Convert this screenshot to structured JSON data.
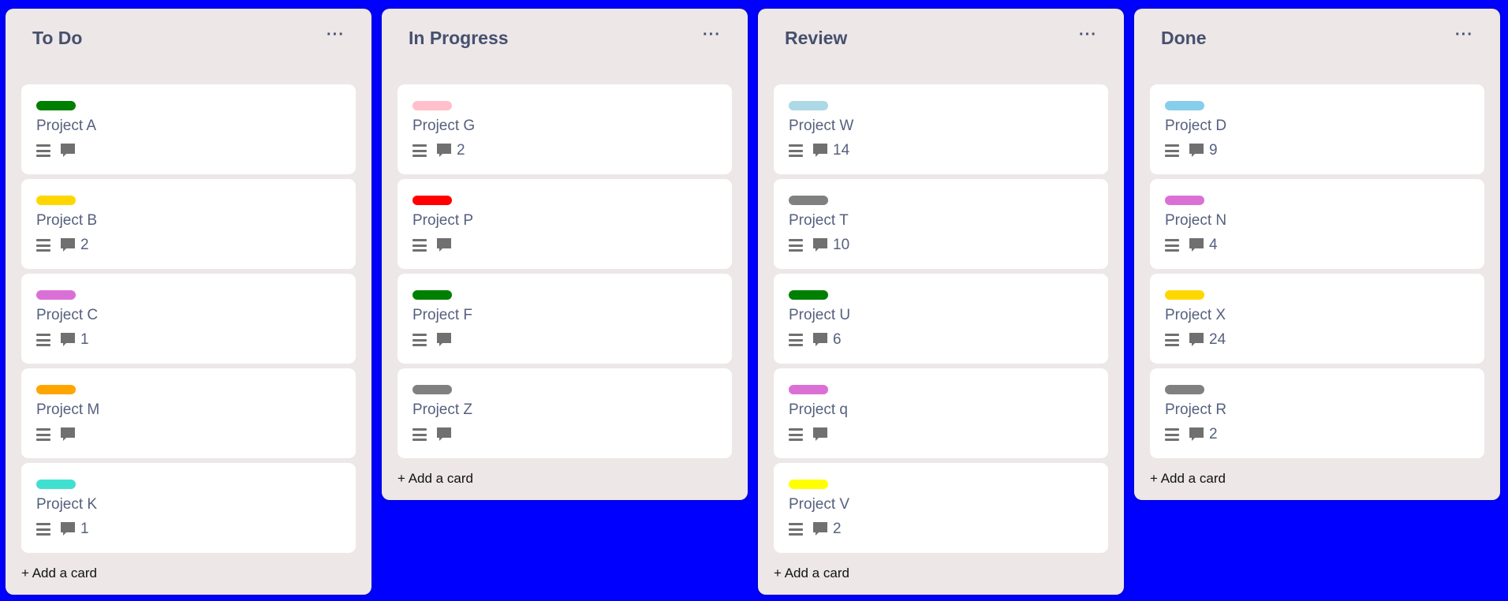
{
  "columns": [
    {
      "title": "To Do",
      "menu": "···",
      "add_card": "+ Add a card",
      "cards": [
        {
          "title": "Project A",
          "label_color": "#008000",
          "comments": ""
        },
        {
          "title": "Project B",
          "label_color": "#ffd700",
          "comments": "2"
        },
        {
          "title": "Project C",
          "label_color": "#da70d6",
          "comments": "1"
        },
        {
          "title": "Project M",
          "label_color": "#ffa500",
          "comments": ""
        },
        {
          "title": "Project K",
          "label_color": "#40e0d0",
          "comments": "1"
        }
      ]
    },
    {
      "title": "In Progress",
      "menu": "···",
      "add_card": "+ Add a card",
      "cards": [
        {
          "title": "Project G",
          "label_color": "#ffc0cb",
          "comments": "2"
        },
        {
          "title": "Project P",
          "label_color": "#ff0000",
          "comments": ""
        },
        {
          "title": "Project F",
          "label_color": "#008000",
          "comments": ""
        },
        {
          "title": "Project Z",
          "label_color": "#808080",
          "comments": ""
        }
      ]
    },
    {
      "title": "Review",
      "menu": "···",
      "add_card": "+ Add a card",
      "cards": [
        {
          "title": "Project W",
          "label_color": "#add8e6",
          "comments": "14"
        },
        {
          "title": "Project T",
          "label_color": "#808080",
          "comments": "10"
        },
        {
          "title": "Project U",
          "label_color": "#008000",
          "comments": "6"
        },
        {
          "title": "Project q",
          "label_color": "#da70d6",
          "comments": ""
        },
        {
          "title": "Project V",
          "label_color": "#ffff00",
          "comments": "2"
        }
      ]
    },
    {
      "title": "Done",
      "menu": "···",
      "add_card": "+ Add a card",
      "cards": [
        {
          "title": "Project D",
          "label_color": "#87ceeb",
          "comments": "9"
        },
        {
          "title": "Project N",
          "label_color": "#da70d6",
          "comments": "4"
        },
        {
          "title": "Project X",
          "label_color": "#ffd700",
          "comments": "24"
        },
        {
          "title": "Project R",
          "label_color": "#808080",
          "comments": "2"
        }
      ]
    }
  ],
  "icons": {
    "description": "description-icon",
    "comment": "comment-icon",
    "menu": "more-icon"
  },
  "colors": {
    "background": "#0000ff",
    "column": "#ede7e7",
    "card": "#ffffff",
    "text": "#46506e"
  }
}
